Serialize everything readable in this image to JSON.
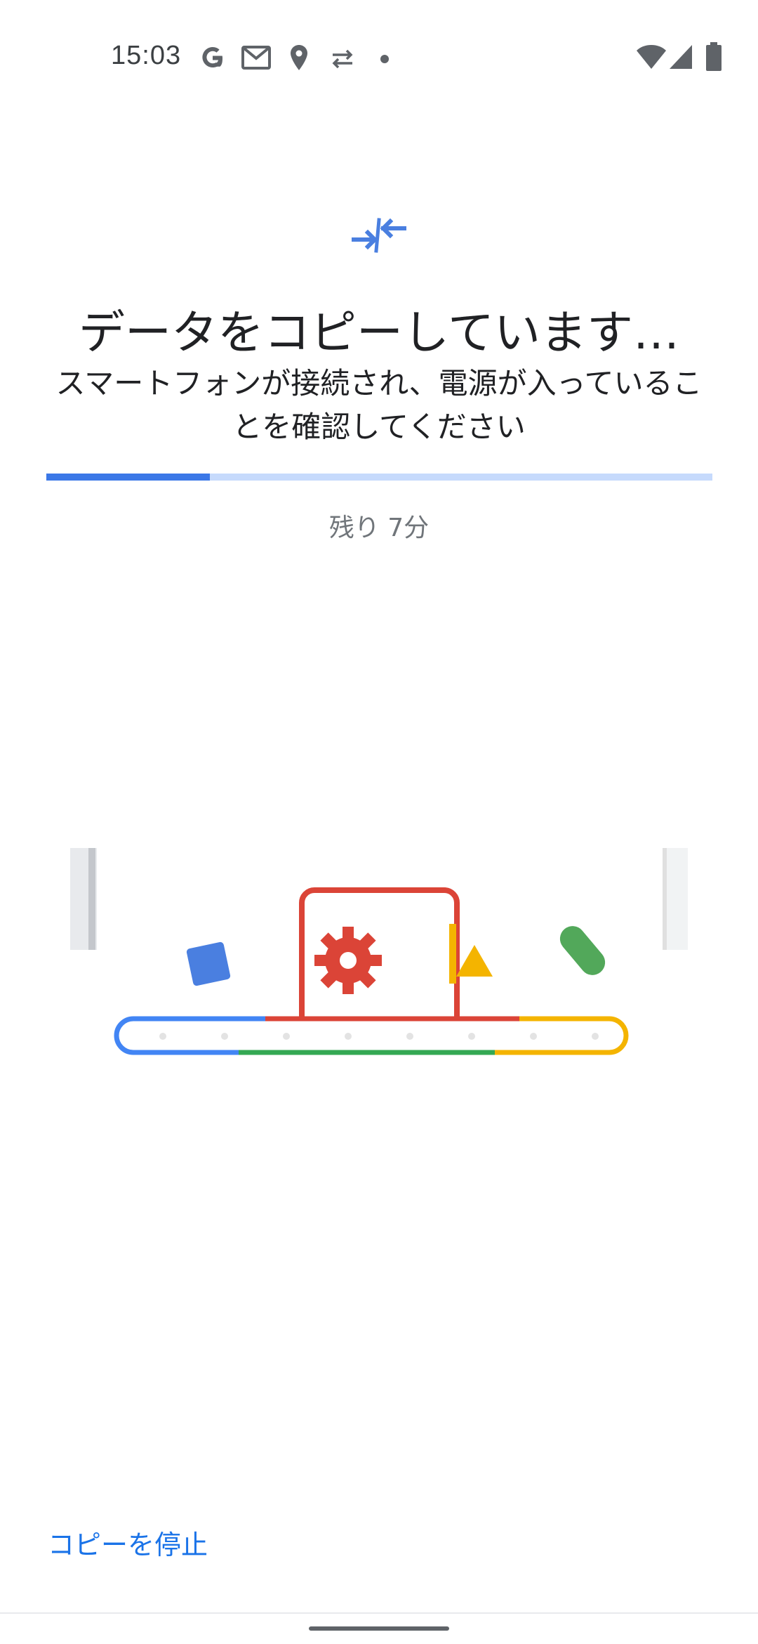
{
  "status_bar": {
    "time": "15:03",
    "left_icons": [
      "google-g-icon",
      "gmail-icon",
      "location-icon",
      "data-transfer-icon",
      "dot-icon"
    ],
    "right_icons": [
      "wifi-icon",
      "cell-signal-icon",
      "battery-icon"
    ]
  },
  "header": {
    "icon": "copy-arrows-icon",
    "title": "データをコピーしています…",
    "subtitle": "スマートフォンが接続され、電源が入っていることを確認してください"
  },
  "progress": {
    "fraction": 0.245,
    "remaining_text": "残り 7分"
  },
  "illustration": {
    "name": "conveyor-copy-animation",
    "colors": {
      "blue": "#4285f4",
      "red": "#db4437",
      "yellow": "#f4b400",
      "green": "#0f9d58"
    }
  },
  "footer": {
    "stop_label": "コピーを停止"
  },
  "colors": {
    "accent": "#1a73e8",
    "progress_track": "#c6dafc",
    "progress_fill": "#3b78e7"
  }
}
